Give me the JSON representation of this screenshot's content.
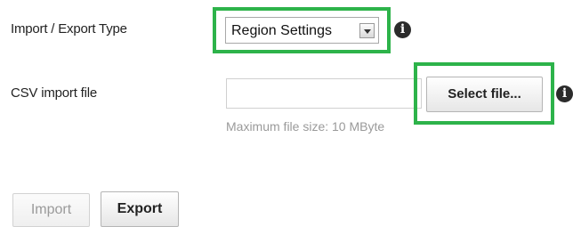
{
  "form": {
    "type_label": "Import / Export Type",
    "type_select": {
      "value": "Region Settings"
    },
    "csv_label": "CSV import file",
    "csv_input": {
      "value": "",
      "placeholder": ""
    },
    "select_file_label": "Select file...",
    "hint": "Maximum file size: 10 MByte",
    "info_glyph": "i"
  },
  "actions": {
    "import_label": "Import",
    "export_label": "Export"
  },
  "colors": {
    "highlight": "#2db34a",
    "info_icon": "#2b2b2b",
    "disabled_text": "#9a9a9a"
  }
}
